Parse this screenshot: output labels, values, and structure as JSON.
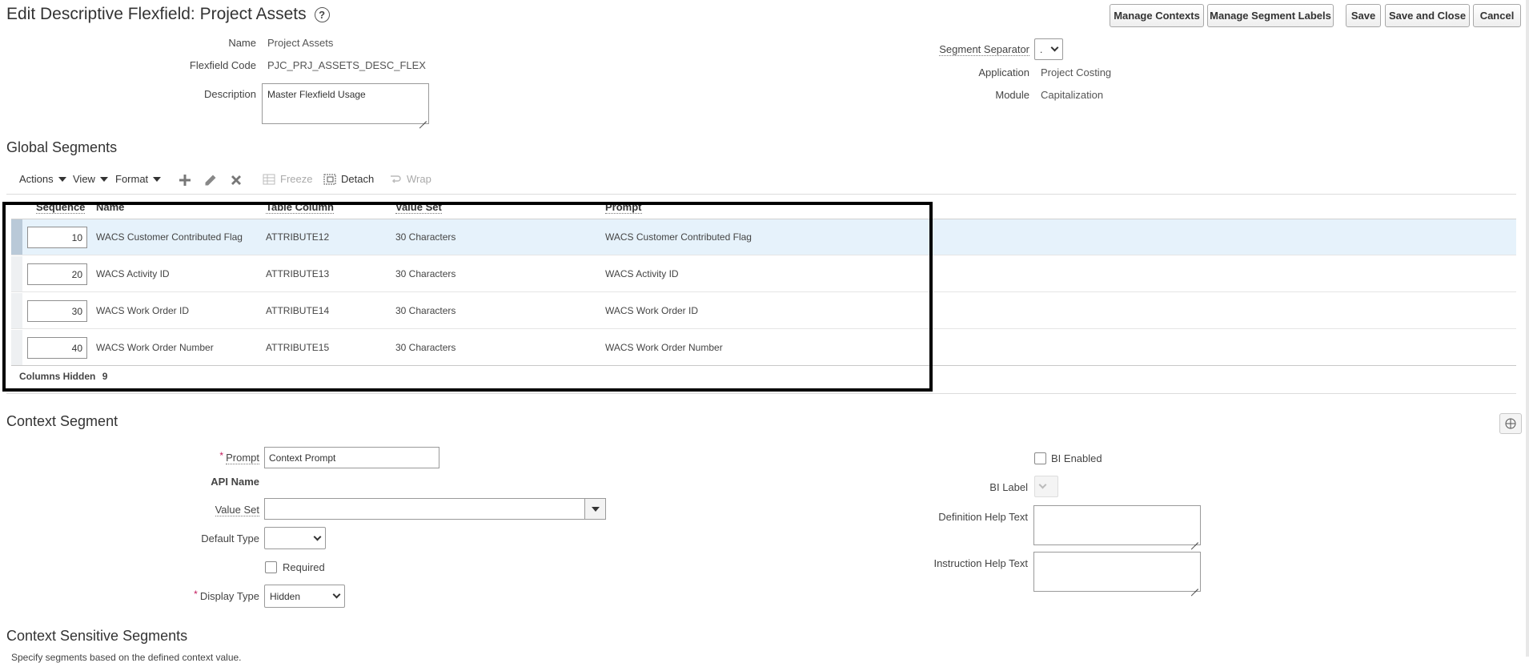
{
  "header": {
    "title": "Edit Descriptive Flexfield: Project Assets",
    "help_glyph": "?",
    "buttons": {
      "manage_contexts": "Manage Contexts",
      "manage_segment_labels": "Manage Segment Labels",
      "save": "Save",
      "save_and_close": "Save and Close",
      "cancel": "Cancel"
    }
  },
  "flexfield": {
    "name_label": "Name",
    "name_value": "Project Assets",
    "code_label": "Flexfield Code",
    "code_value": "PJC_PRJ_ASSETS_DESC_FLEX",
    "description_label": "Description",
    "description_value": "Master Flexfield Usage",
    "separator_label": "Segment Separator",
    "separator_value": ".",
    "application_label": "Application",
    "application_value": "Project Costing",
    "module_label": "Module",
    "module_value": "Capitalization"
  },
  "global_segments": {
    "title": "Global Segments",
    "toolbar": {
      "actions": "Actions",
      "view": "View",
      "format": "Format",
      "freeze": "Freeze",
      "detach": "Detach",
      "wrap": "Wrap"
    },
    "columns": [
      "Sequence",
      "Name",
      "Table Column",
      "Value Set",
      "Prompt"
    ],
    "rows": [
      {
        "sequence": "10",
        "name": "WACS Customer Contributed Flag",
        "table_column": "ATTRIBUTE12",
        "value_set": "30 Characters",
        "prompt": "WACS Customer Contributed Flag"
      },
      {
        "sequence": "20",
        "name": "WACS Activity ID",
        "table_column": "ATTRIBUTE13",
        "value_set": "30 Characters",
        "prompt": "WACS Activity ID"
      },
      {
        "sequence": "30",
        "name": "WACS Work Order ID",
        "table_column": "ATTRIBUTE14",
        "value_set": "30 Characters",
        "prompt": "WACS Work Order ID"
      },
      {
        "sequence": "40",
        "name": "WACS Work Order Number",
        "table_column": "ATTRIBUTE15",
        "value_set": "30 Characters",
        "prompt": "WACS Work Order Number"
      }
    ],
    "columns_hidden_label": "Columns Hidden",
    "columns_hidden_count": "9"
  },
  "context_segment": {
    "title": "Context Segment",
    "prompt_label": "Prompt",
    "prompt_value": "Context Prompt",
    "api_name_label": "API Name",
    "value_set_label": "Value Set",
    "value_set_value": "",
    "default_type_label": "Default Type",
    "default_type_value": "",
    "required_label": "Required",
    "display_type_label": "Display Type",
    "display_type_value": "Hidden",
    "bi_enabled_label": "BI Enabled",
    "bi_label_label": "BI Label",
    "definition_help_label": "Definition Help Text",
    "instruction_help_label": "Instruction Help Text",
    "required_star": "*"
  },
  "context_sensitive": {
    "title": "Context Sensitive Segments",
    "subtitle": "Specify segments based on the defined context value."
  },
  "colors": {
    "selected_row": "#e6f2fb",
    "highlight_frame": "#000000"
  }
}
